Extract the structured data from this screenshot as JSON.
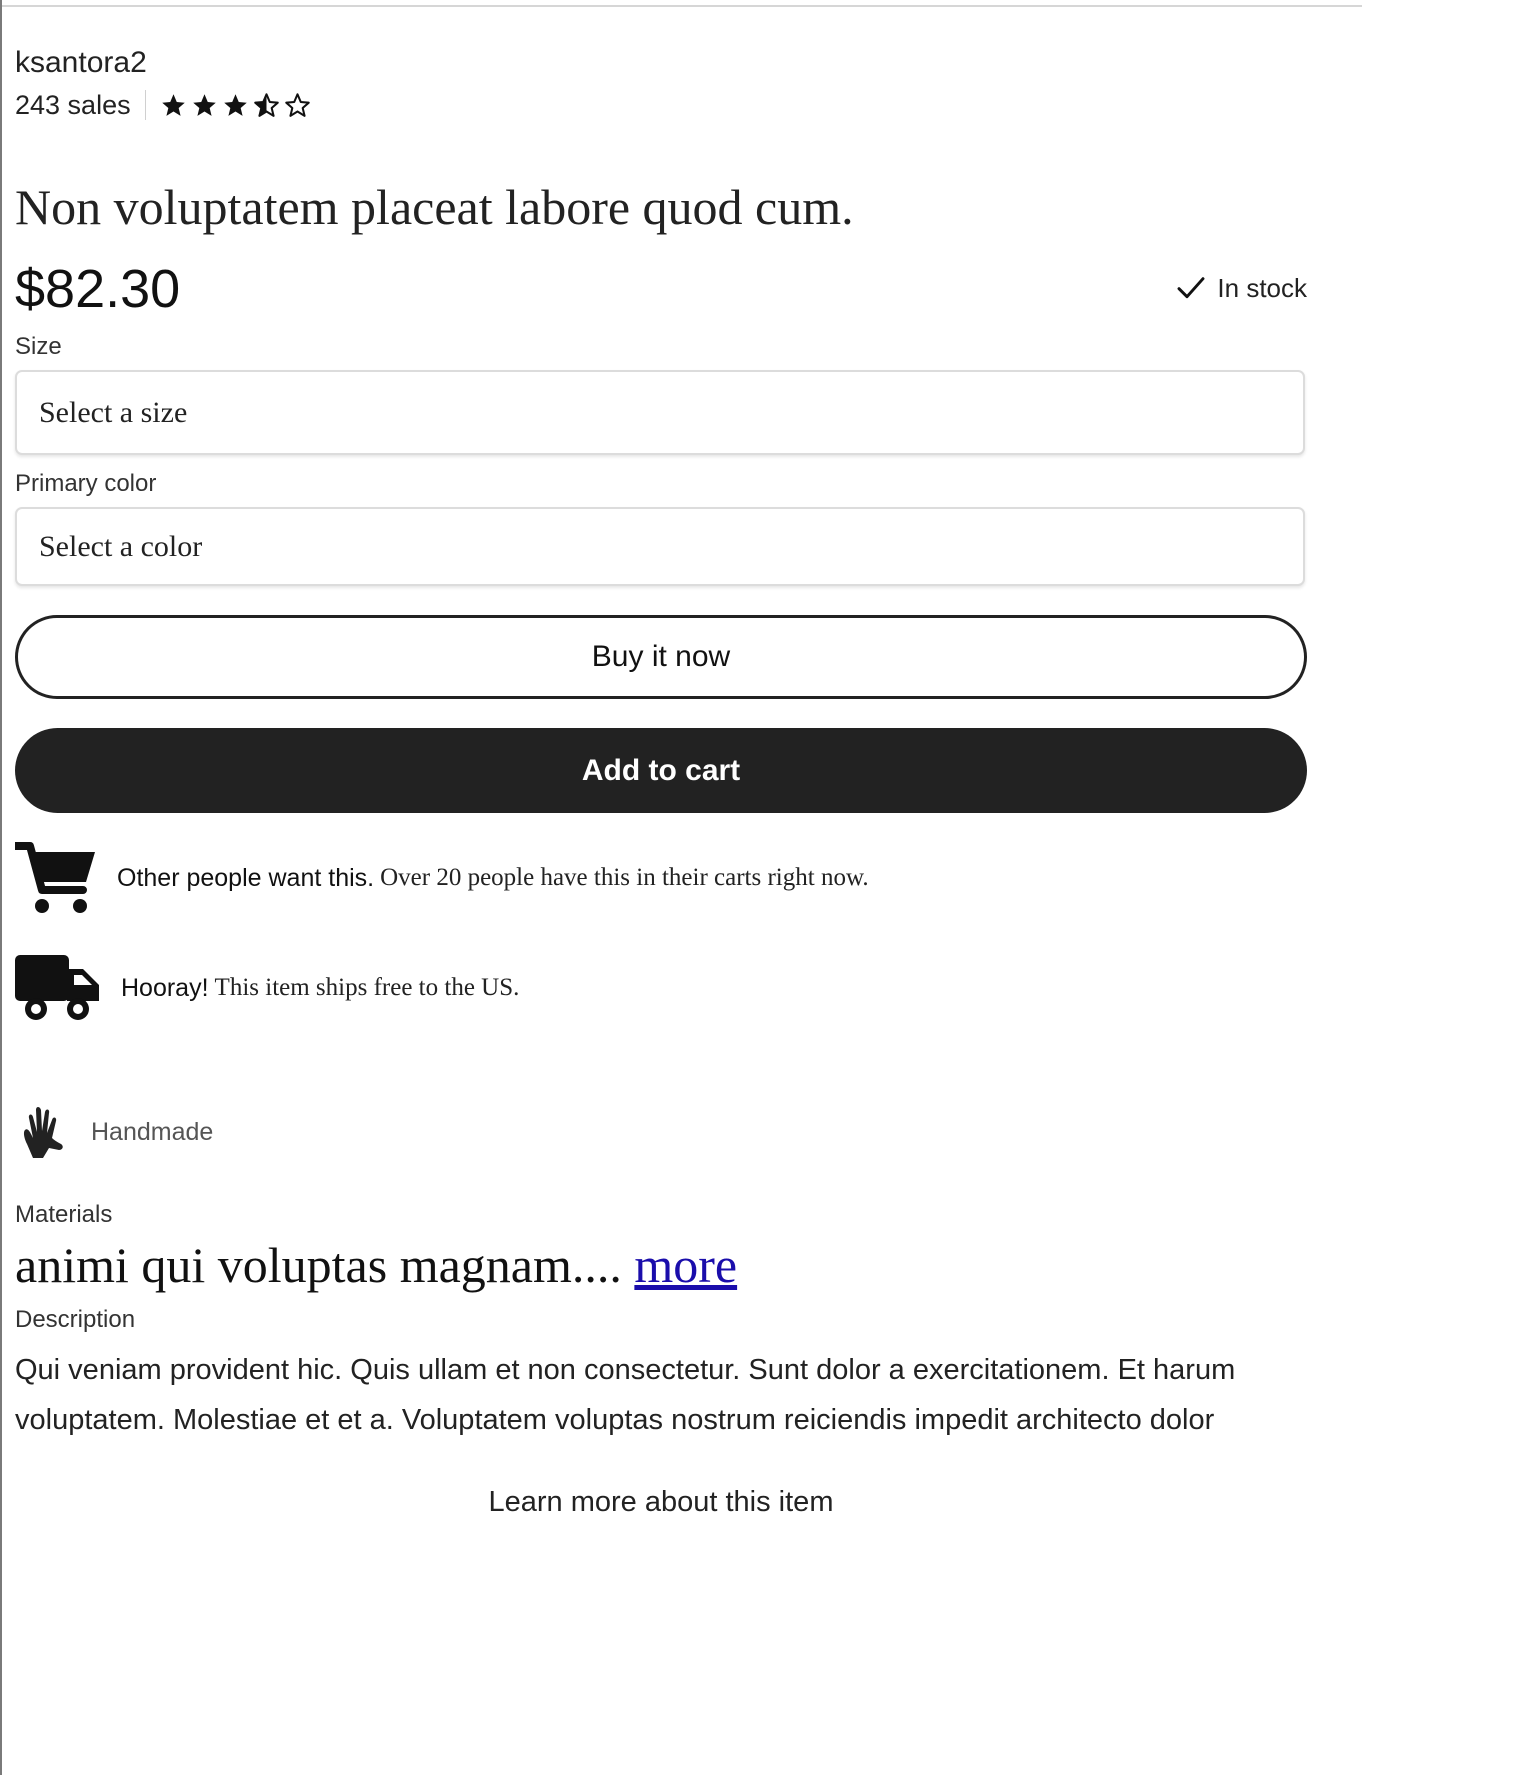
{
  "shop": {
    "name": "ksantora2",
    "sales": "243 sales",
    "rating": 3.5,
    "rating_max": 5
  },
  "listing": {
    "title": "Non voluptatem placeat labore quod cum.",
    "price": "$82.30",
    "stock_status": "In stock"
  },
  "options": {
    "size_label": "Size",
    "size_placeholder": "Select a size",
    "color_label": "Primary color",
    "color_placeholder": "Select a color"
  },
  "actions": {
    "buy_now": "Buy it now",
    "add_to_cart": "Add to cart"
  },
  "highlights": {
    "cart_strong": "Other people want this.",
    "cart_text": "Over 20 people have this in their carts right now.",
    "cart_icon": "shopping-cart-icon",
    "shipping_strong": "Hooray!",
    "shipping_text": "This item ships free to the US.",
    "shipping_icon": "delivery-truck-icon",
    "handmade_label": "Handmade",
    "handmade_icon": "hand-icon"
  },
  "details": {
    "materials_label": "Materials",
    "materials_text": "animi qui voluptas magnam....",
    "materials_more": "more",
    "description_label": "Description",
    "description_text": "Qui veniam provident hic. Quis ullam et non consectetur. Sunt dolor a exercitationem. Et harum voluptatem. Molestiae et et a. Voluptatem voluptas nostrum reiciendis impedit architecto dolor",
    "learn_more": "Learn more about this item"
  },
  "colors": {
    "text": "#222222",
    "cart_button": "#222222",
    "link": "#1a0dab",
    "border": "#dcdcdc"
  }
}
